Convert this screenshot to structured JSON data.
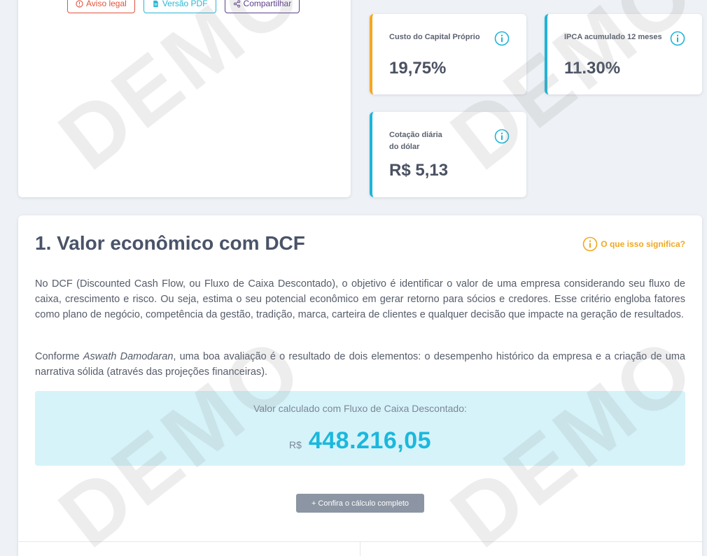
{
  "toolbar": {
    "legal_label": "Aviso legal",
    "pdf_label": "Versão PDF",
    "share_label": "Compartilhar"
  },
  "indicators": {
    "capital_title": "Custo do Capital Próprio",
    "capital_value": "19,75%",
    "ipca_title": "IPCA acumulado 12 meses",
    "ipca_value": "11.30%",
    "dolar_title_line1": "Cotação diária",
    "dolar_title_line2": "do dólar",
    "dolar_value": "R$ 5,13"
  },
  "section": {
    "title": "1. Valor econômico com DCF",
    "meaning_link": "O que isso significa?",
    "paragraph1": "No DCF (Discounted Cash Flow, ou Fluxo de Caixa Descontado), o objetivo é identificar o valor de uma empresa considerando seu fluxo de caixa, crescimento e risco. Ou seja, estima o seu potencial econômico em gerar retorno para sócios e credores. Esse critério engloba fatores como plano de negócio, competência da gestão, tradição, marca, carteira de clientes e qualquer decisão que impacte na geração de resultados.",
    "paragraph2_prefix": "Conforme ",
    "paragraph2_author": "Aswath Damodaran",
    "paragraph2_rest": ", uma boa avaliação é o resultado de dois elementos: o desempenho histórico da empresa e a criação de uma narrativa sólida (através das projeções financeiras).",
    "result_label": "Valor calculado com Fluxo de Caixa Descontado:",
    "result_currency": "R$",
    "result_amount": "448.216,05",
    "calc_button": "+ Confira o cálculo completo"
  },
  "watermark": "DEMO",
  "colors": {
    "accent_orange": "#f5a623",
    "accent_cyan": "#1fb4d8",
    "result_bg": "#d6f3fa",
    "result_amount": "#1bb8dd"
  },
  "icons": [
    "info-icon",
    "alert-circle-icon",
    "file-pdf-icon",
    "share-icon"
  ]
}
